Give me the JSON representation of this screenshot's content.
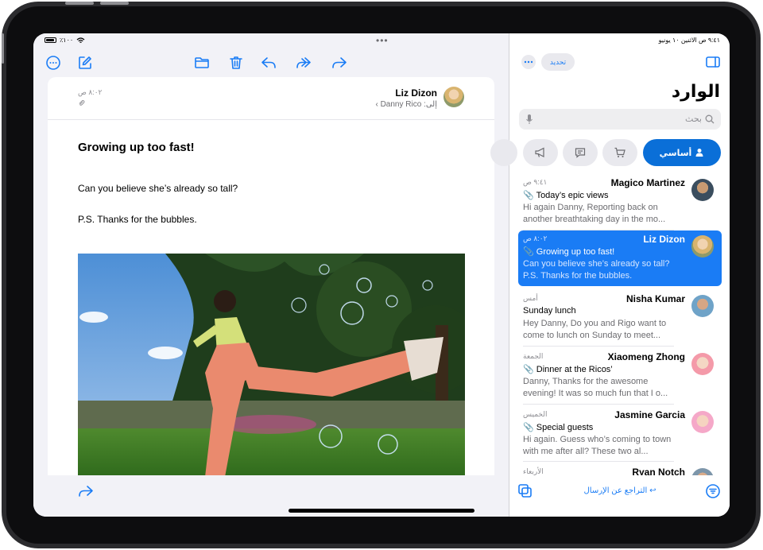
{
  "status_bar": {
    "battery": "٪١٠٠",
    "datetime": "٩:٤١ ص   الاثنين ١٠ يونيو"
  },
  "message": {
    "sender": "Liz Dizon",
    "to": "إلى: Danny Rico ›",
    "time": "٨:٠٢ ص",
    "subject": "Growing up too fast!",
    "body": [
      "Can you believe she’s already so tall?",
      "P.S. Thanks for the bubbles."
    ]
  },
  "sidebar": {
    "edit_label": "تحديد",
    "title": "الوارد",
    "search_placeholder": "بحث",
    "categories": [
      {
        "label": "أساسي",
        "icon": "person-icon"
      },
      {
        "icon": "cart-icon"
      },
      {
        "icon": "chat-bubble-icon"
      },
      {
        "icon": "megaphone-icon"
      }
    ],
    "messages": [
      {
        "sender": "Magico Martinez",
        "time": "٩:٤١ ص",
        "subject": "Today’s epic views",
        "preview": "Hi again Danny, Reporting back on another breathtaking day in the mo...",
        "attachment": true
      },
      {
        "sender": "Liz Dizon",
        "time": "٨:٠٢ ص",
        "subject": "Growing up too fast!",
        "preview": "Can you believe she’s already so tall? P.S. Thanks for the bubbles.",
        "attachment": true
      },
      {
        "sender": "Nisha Kumar",
        "time": "أمس",
        "subject": "Sunday lunch",
        "preview": "Hey Danny, Do you and Rigo want to come to lunch on Sunday to meet...",
        "attachment": false
      },
      {
        "sender": "Xiaomeng Zhong",
        "time": "الجمعة",
        "subject": "Dinner at the Ricos’",
        "preview": "Danny, Thanks for the awesome evening! It was so much fun that I o...",
        "attachment": true
      },
      {
        "sender": "Jasmine Garcia",
        "time": "الخميس",
        "subject": "Special guests",
        "preview": "Hi again. Guess who’s coming to town with me after all? These two al...",
        "attachment": true
      },
      {
        "sender": "Ryan Notch",
        "time": "الأربعاء",
        "subject": "",
        "preview": "",
        "attachment": false
      }
    ],
    "undo_send": "↩ التراجع عن الإرسال"
  },
  "colors": {
    "accent": "#1a7cf5",
    "selected_row": "#1a7cf5",
    "category_active": "#0a6fd8"
  }
}
